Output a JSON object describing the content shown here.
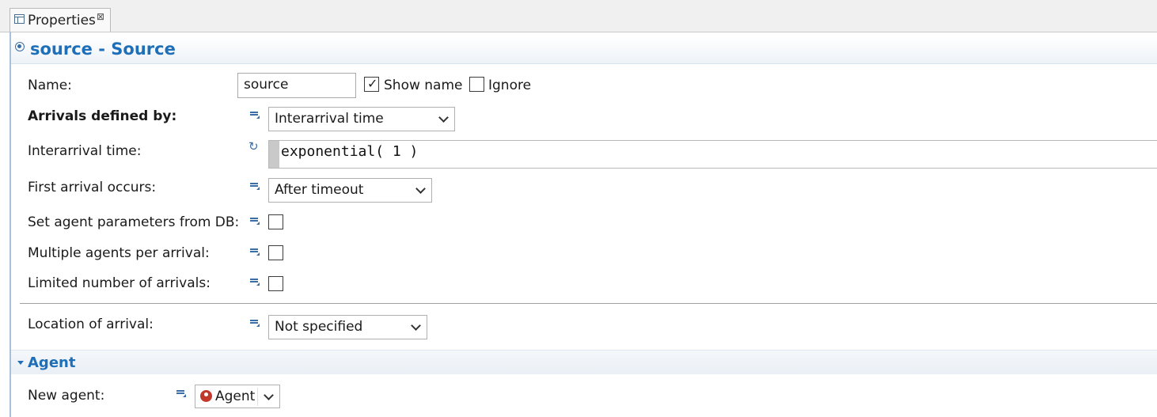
{
  "tab": {
    "label": "Properties",
    "close": "⊠"
  },
  "header": {
    "title": "source - Source"
  },
  "fields": {
    "name": {
      "label": "Name:",
      "value": "source"
    },
    "show_name": {
      "label": "Show name",
      "checked": true
    },
    "ignore": {
      "label": "Ignore",
      "checked": false
    },
    "arrivals_defined_by": {
      "label": "Arrivals defined by:",
      "value": "Interarrival time"
    },
    "interarrival_time": {
      "label": "Interarrival time:",
      "value": "exponential( 1 )"
    },
    "first_arrival": {
      "label": "First arrival occurs:",
      "value": "After timeout"
    },
    "set_params_db": {
      "label": "Set agent parameters from DB:",
      "checked": false
    },
    "multiple_agents": {
      "label": "Multiple agents per arrival:",
      "checked": false
    },
    "limited_arrivals": {
      "label": "Limited number of arrivals:",
      "checked": false
    },
    "location_of_arrival": {
      "label": "Location of arrival:",
      "value": "Not specified"
    }
  },
  "agent_section": {
    "title": "Agent",
    "new_agent": {
      "label": "New agent:",
      "value": "Agent"
    }
  },
  "colors": {
    "accent": "#1f6fb8",
    "agent_icon": "#c0392b"
  }
}
